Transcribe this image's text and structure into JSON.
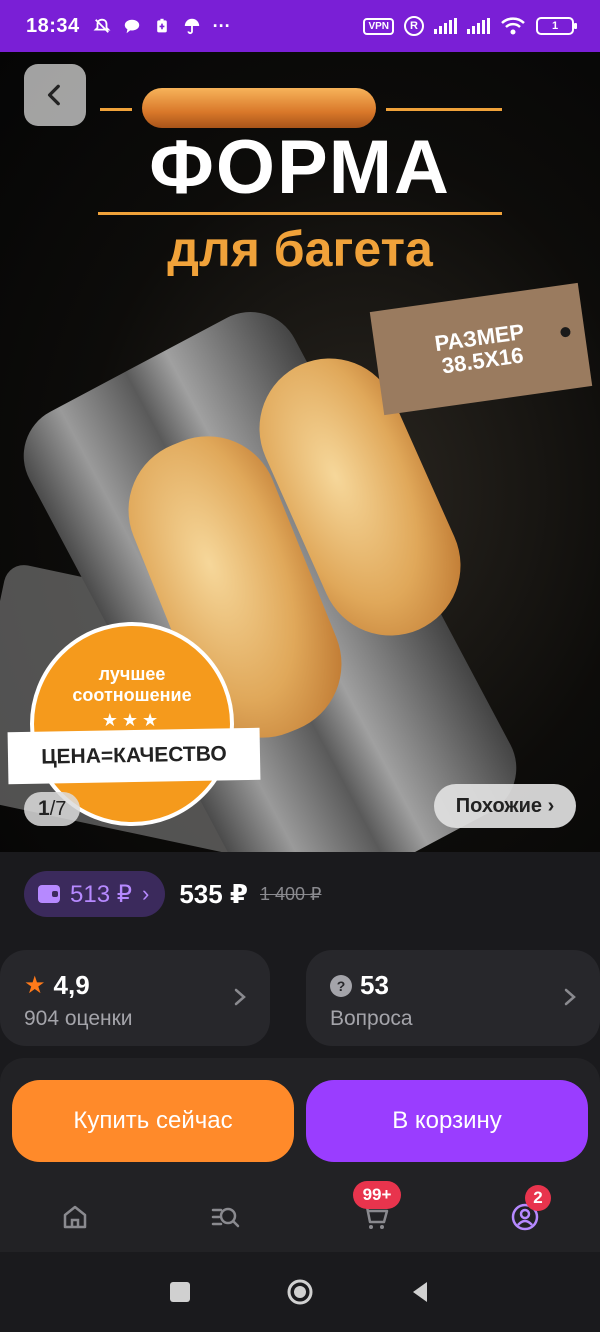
{
  "status_bar": {
    "time": "18:34",
    "icons": [
      "bell-off-icon",
      "chat-icon",
      "battery-saver-icon",
      "umbrella-icon",
      "more-icon"
    ],
    "vpn_label": "VPN",
    "r_label": "R",
    "battery_level": "1"
  },
  "hero": {
    "title": "ФОРМА",
    "subtitle": "для багета",
    "tag_line1": "РАЗМЕР",
    "tag_line2": "38.5X16",
    "badge_line1": "лучшее",
    "badge_line2": "соотношение",
    "badge_stars": "★★★",
    "ribbon_text": "ЦЕНА=КАЧЕСТВО",
    "counter_current": "1",
    "counter_sep": "/",
    "counter_total": "7",
    "similar_label": "Похожие ›"
  },
  "price": {
    "wallet_price": "513 ₽",
    "wallet_chevron": "›",
    "current": "535 ₽",
    "old": "1 400 ₽"
  },
  "rating_card": {
    "value": "4,9",
    "label": "904 оценки"
  },
  "questions_card": {
    "value": "53",
    "label": "Вопроса",
    "icon_text": "?"
  },
  "actions": {
    "buy_now": "Купить сейчас",
    "add_to_cart": "В корзину"
  },
  "nav": {
    "cart_badge": "99+",
    "profile_badge": "2"
  },
  "colors": {
    "status_bar": "#7a1fd6",
    "buy_button": "#ff8a2a",
    "cart_button": "#9a3dff",
    "wallet_text": "#b689ff",
    "badge_red": "#e8344d",
    "star_orange": "#ff7a1a"
  }
}
